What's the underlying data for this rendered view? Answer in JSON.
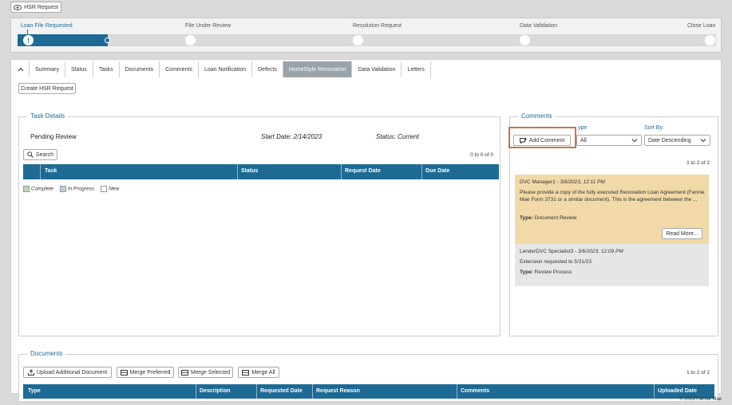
{
  "header": {
    "hsr_button": "HSR Request",
    "icon": "eye-icon"
  },
  "progress": {
    "stages": [
      "Loan File Requested",
      "File Under Review",
      "Resolution Request",
      "Data Validation",
      "Close Loan"
    ],
    "current_stage": "Loan File Requested",
    "colors": {
      "active": "#1d6a94",
      "track": "#dadada"
    }
  },
  "tabs": [
    "Summary",
    "Status",
    "Tasks",
    "Documents",
    "Comments",
    "Loan Notification",
    "Defects",
    "HomeStyle Renovation",
    "Data Validation",
    "Letters"
  ],
  "selected_tab": "HomeStyle Renovation",
  "create_hsr_button": "Create HSR Request",
  "task_details": {
    "title": "Task Details",
    "status_label": "Pending Review",
    "start_date": "Start Date: 2/14/2023",
    "status": "Status: Current",
    "search_button": "Search",
    "count": "0 to 0 of 0",
    "columns": [
      "Task",
      "Status",
      "Request Date",
      "Due Date"
    ],
    "legend": [
      {
        "label": "Complete",
        "color": "#b9d9b3"
      },
      {
        "label": "In Progress",
        "color": "#b5d3e3"
      },
      {
        "label": "New",
        "color": "#ffffff"
      }
    ]
  },
  "comments": {
    "title": "Comments",
    "add_button": "Add Comment",
    "type_label": "ype",
    "type_value": "All",
    "sort_label": "Sort By:",
    "sort_value": "Date Descending",
    "count": "1 to 2 of 2",
    "items": [
      {
        "author": "DVC Manager1",
        "date": " - 3/6/2023, 12:11 PM",
        "body": "Please provide a copy of the fully executed Renovation Loan Agreement (Fannie Mae Form 3731 or a similar document). This is the agreement between the ...",
        "type_label": "Type:",
        "type": "Document Review",
        "read_more": "Read More...",
        "bg": "#f1d9a8"
      },
      {
        "author": "LenderDVC Specialist3",
        "date": " - 3/6/2023, 12:09 PM",
        "body": "Extension requested to 5/31/23",
        "type_label": "Type:",
        "type": "Review Process",
        "bg": "#e6e6e6"
      }
    ]
  },
  "documents": {
    "title": "Documents",
    "buttons": [
      "Upload Additional Document",
      "Merge Preferred",
      "Merge Selected",
      "Merge All"
    ],
    "count": "1 to 2 of 2",
    "columns": [
      "Type",
      "Description",
      "Requested Date",
      "Request Reason",
      "Comments",
      "Uploaded Date"
    ]
  },
  "footer": {
    "copyright": "© 2019 Fannie Mae"
  }
}
